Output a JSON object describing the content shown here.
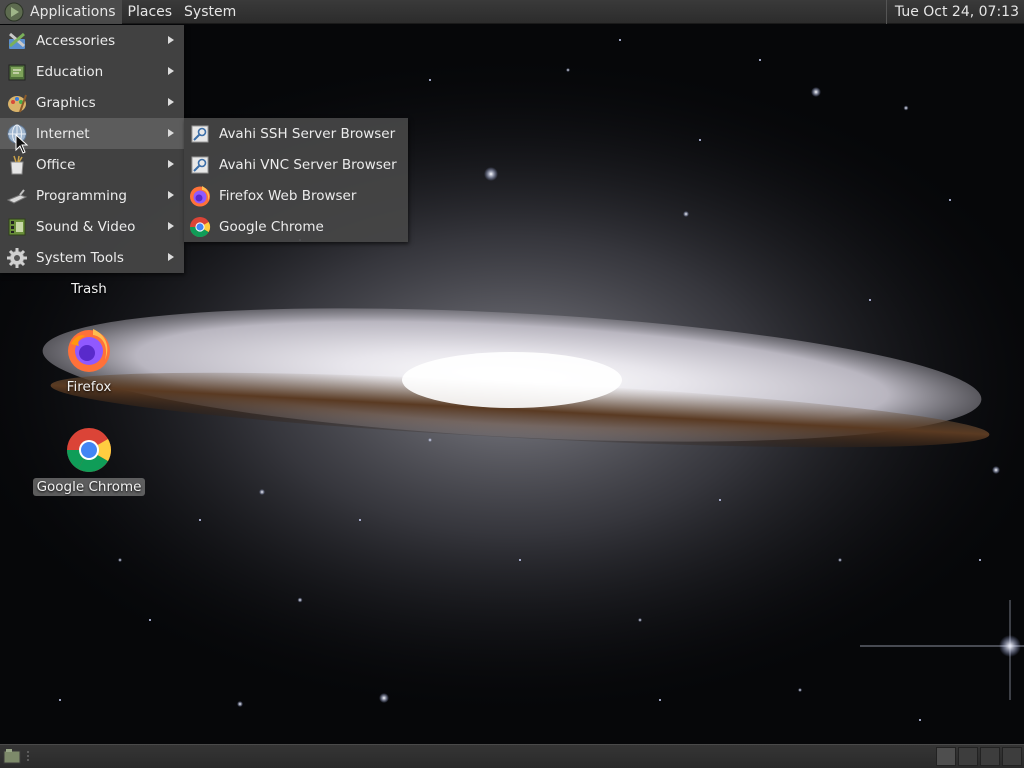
{
  "top_panel": {
    "menus": [
      "Applications",
      "Places",
      "System"
    ],
    "clock": "Tue Oct 24, 07:13"
  },
  "applications_menu": {
    "items": [
      {
        "label": "Accessories",
        "icon": "accessories-icon"
      },
      {
        "label": "Education",
        "icon": "education-icon"
      },
      {
        "label": "Graphics",
        "icon": "graphics-icon"
      },
      {
        "label": "Internet",
        "icon": "internet-globe-icon",
        "highlighted": true
      },
      {
        "label": "Office",
        "icon": "office-icon"
      },
      {
        "label": "Programming",
        "icon": "programming-icon"
      },
      {
        "label": "Sound & Video",
        "icon": "sound-video-icon"
      },
      {
        "label": "System Tools",
        "icon": "system-tools-gear-icon"
      }
    ]
  },
  "internet_submenu": {
    "items": [
      {
        "label": "Avahi SSH Server Browser",
        "icon": "avahi-ssh-icon"
      },
      {
        "label": "Avahi VNC Server Browser",
        "icon": "avahi-vnc-icon"
      },
      {
        "label": "Firefox Web Browser",
        "icon": "firefox-icon"
      },
      {
        "label": "Google Chrome",
        "icon": "chrome-icon"
      }
    ]
  },
  "desktop": {
    "icons": [
      {
        "label": "Trash",
        "icon": "trash-icon"
      },
      {
        "label": "Firefox",
        "icon": "firefox-icon"
      },
      {
        "label": "Google Chrome",
        "icon": "chrome-icon",
        "selected": true
      }
    ]
  },
  "bottom_panel": {
    "workspaces": 4,
    "active_workspace": 1
  }
}
